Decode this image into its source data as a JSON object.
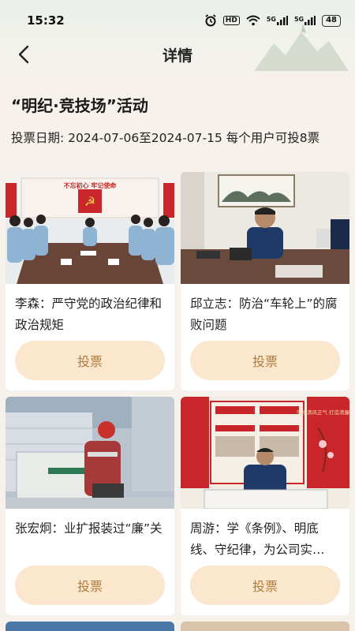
{
  "status_bar": {
    "time": "15:32",
    "hd_label": "HD",
    "signal1_label": "5G",
    "signal2_label": "5G",
    "battery": "48"
  },
  "nav": {
    "title": "详情"
  },
  "event": {
    "title": "“明纪·竞技场”活动",
    "vote_info": "投票日期: 2024-07-06至2024-07-15 每个用户可投8票"
  },
  "candidates": [
    {
      "name": "李森：严守党的政治纪律和政治规矩",
      "vote_label": "投票"
    },
    {
      "name": "邱立志：防治“车轮上”的腐败问题",
      "vote_label": "投票"
    },
    {
      "name": "张宏炯：业扩报装过“廉”关",
      "vote_label": "投票"
    },
    {
      "name": "周游：学《条例》、明底线、守纪律，为公司实…",
      "vote_label": "投票"
    }
  ],
  "photo_texts": {
    "p1_banner": "不忘初心  牢记使命",
    "p4_banner": "弘扬清风正气 打造清廉企业"
  },
  "colors": {
    "background": "#f6f1ea",
    "vote_button_bg": "#fbe7cd",
    "vote_button_text": "#b07b3a"
  },
  "icons": [
    "back-arrow-icon",
    "alarm-icon",
    "wifi-icon",
    "signal-icon",
    "battery-icon"
  ]
}
